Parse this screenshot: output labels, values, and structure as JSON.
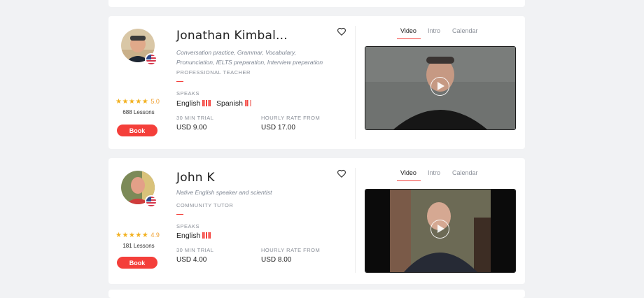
{
  "tutors": [
    {
      "name": "Jonathan Kimbal...",
      "tags_line1": "Conversation practice, Grammar, Vocabulary,",
      "tags_line2": "Pronunciation, IELTS preparation, Interview preparation",
      "role": "PROFESSIONAL TEACHER",
      "rating": "5.0",
      "stars": "★★★★★",
      "lessons": "688 Lessons",
      "book_label": "Book",
      "speaks_label": "SPEAKS",
      "languages": [
        "English",
        "Spanish"
      ],
      "trial_label": "30 MIN TRIAL",
      "trial_price": "USD 9.00",
      "rate_label": "HOURLY RATE FROM",
      "rate_price": "USD 17.00",
      "tabs": [
        "Video",
        "Intro",
        "Calendar"
      ],
      "active_tab": "Video"
    },
    {
      "name": "John K",
      "tags_line1": "Native English speaker and scientist",
      "role": "COMMUNITY TUTOR",
      "rating": "4.9",
      "stars": "★★★★★",
      "lessons": "181 Lessons",
      "book_label": "Book",
      "speaks_label": "SPEAKS",
      "languages": [
        "English"
      ],
      "trial_label": "30 MIN TRIAL",
      "trial_price": "USD 4.00",
      "rate_label": "HOURLY RATE FROM",
      "rate_price": "USD 8.00",
      "tabs": [
        "Video",
        "Intro",
        "Calendar"
      ],
      "active_tab": "Video"
    }
  ],
  "colors": {
    "accent": "#f43f3a",
    "star": "#f2b01e",
    "muted": "#8a8f98"
  },
  "icons": [
    "heart-icon",
    "play-icon",
    "star-icon",
    "flag-icon"
  ]
}
